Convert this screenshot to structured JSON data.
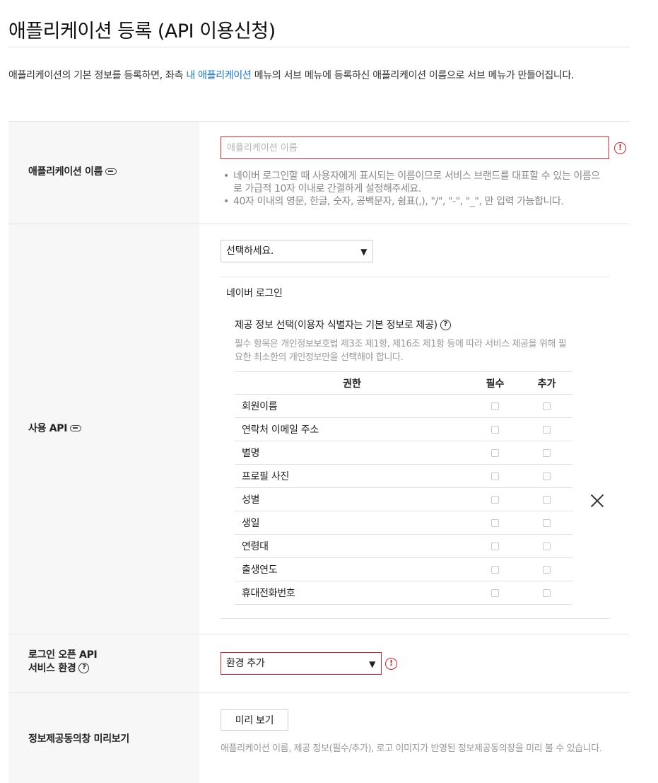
{
  "page": {
    "title": "애플리케이션 등록 (API 이용신청)",
    "intro_before": "애플리케이션의 기본 정보를 등록하면, 좌측 ",
    "intro_link": "내 애플리케이션",
    "intro_after": " 메뉴의 서브 메뉴에 등록하신 애플리케이션 이름으로 서브 메뉴가 만들어집니다."
  },
  "app_name": {
    "label": "애플리케이션 이름",
    "placeholder": "애플리케이션 이름",
    "hints": [
      "네이버 로그인할 때 사용자에게 표시되는 이름이므로 서비스 브랜드를 대표할 수 있는 이름으로 가급적 10자 이내로 간결하게 설정해주세요.",
      "40자 이내의 영문, 한글, 숫자, 공백문자, 쉼표(,), \"/\", \"-\", \"_\", 만 입력 가능합니다."
    ]
  },
  "api": {
    "label": "사용 API",
    "select_value": "선택하세요.",
    "name": "네이버 로그인",
    "provide_title": "제공 정보 선택(이용자 식별자는 기본 정보로 제공)",
    "provide_desc": "필수 항목은 개인정보보호법 제3조 제1항, 제16조 제1항 등에 따라 서비스 제공을 위해 필요한 최소한의 개인정보만을 선택해야 합니다.",
    "columns": [
      "권한",
      "필수",
      "추가"
    ],
    "rows": [
      "회원이름",
      "연락처 이메일 주소",
      "별명",
      "프로필 사진",
      "성별",
      "생일",
      "연령대",
      "출생연도",
      "휴대전화번호"
    ]
  },
  "env": {
    "label_line1": "로그인 오픈 API",
    "label_line2": "서비스 환경",
    "select_value": "환경 추가"
  },
  "preview": {
    "label": "정보제공동의창 미리보기",
    "button": "미리 보기",
    "desc": "애플리케이션 이름, 제공 정보(필수/추가), 로고 이미지가 반영된 정보제공동의창을 미리 볼 수 있습니다."
  },
  "icons": {
    "warning": "!",
    "help": "?",
    "dropdown": "▼"
  },
  "colors": {
    "accent_link": "#1a73c8",
    "error_red": "#c5292f",
    "label_bg": "#f7f7f7"
  }
}
